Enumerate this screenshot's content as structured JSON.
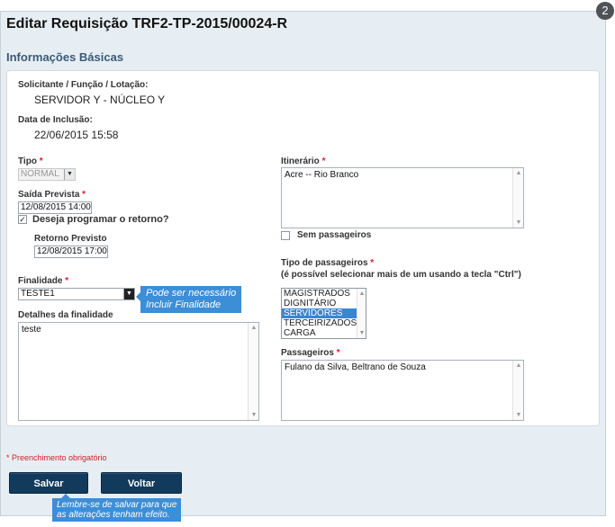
{
  "badge": "2",
  "page_title": "Editar Requisição TRF2-TP-2015/00024-R",
  "section_title": "Informações Básicas",
  "solicitante": {
    "label": "Solicitante / Função / Lotação:",
    "value": "SERVIDOR Y - NÚCLEO Y"
  },
  "data_inclusao": {
    "label": "Data de Inclusão:",
    "value": "22/06/2015 15:58"
  },
  "tipo": {
    "label": "Tipo",
    "required_mark": "*",
    "selected": "NORMAL"
  },
  "saida_prevista": {
    "label": "Saída Prevista",
    "required_mark": "*",
    "value": "12/08/2015 14:00"
  },
  "programar_retorno": {
    "label": "Deseja programar o retorno?",
    "checked": true
  },
  "retorno_previsto": {
    "label": "Retorno Previsto",
    "value": "12/08/2015 17:00"
  },
  "finalidade": {
    "label": "Finalidade",
    "required_mark": "*",
    "selected": "TESTE1",
    "tooltip_line1": "Pode ser necessário",
    "tooltip_line2": "Incluir Finalidade"
  },
  "detalhes_finalidade": {
    "label": "Detalhes da finalidade",
    "value": "teste"
  },
  "itinerario": {
    "label": "Itinerário",
    "required_mark": "*",
    "value": "Acre -- Rio Branco"
  },
  "sem_passageiros": {
    "label": "Sem passageiros",
    "checked": false
  },
  "tipo_passageiros": {
    "label": "Tipo de passageiros",
    "required_mark": "*",
    "hint": "(é possível selecionar mais de um usando a tecla \"Ctrl\")",
    "options": [
      "MAGISTRADOS",
      "DIGNITÁRIO",
      "SERVIDORES",
      "TERCEIRIZADOS",
      "CARGA"
    ],
    "selected": "SERVIDORES"
  },
  "passageiros": {
    "label": "Passageiros",
    "required_mark": "*",
    "value": "Fulano da Silva, Beltrano de Souza"
  },
  "required_note": "* Preenchimento obrigatório",
  "buttons": {
    "save": "Salvar",
    "back": "Voltar"
  },
  "save_tooltip": {
    "line1": "Lembre-se de salvar para que",
    "line2": "as alterações tenham efeito."
  },
  "colors": {
    "section_title": "#3b5a78",
    "button_bg": "#123a5c",
    "tooltip_bg": "#3c8ed6",
    "required": "#d0202c",
    "selected_option": "#3a86d1"
  },
  "icons": {
    "dropdown": "triangle-down",
    "checkbox_check": "check-mark",
    "scroll_up": "triangle-up",
    "scroll_down": "triangle-down"
  }
}
